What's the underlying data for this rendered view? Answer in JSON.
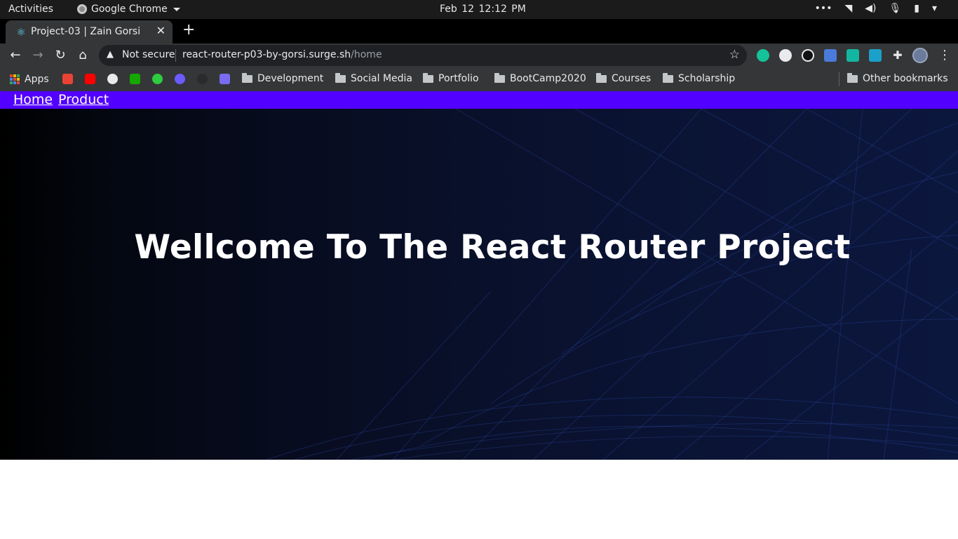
{
  "system": {
    "activities": "Activities",
    "app_name": "Google Chrome",
    "clock": "Feb 12  12:12 PM"
  },
  "browser": {
    "tab_title": "Project-03 | Zain Gorsi",
    "address": {
      "security": "Not secure",
      "host": "react-router-p03-by-gorsi.surge.sh",
      "path": "/home"
    },
    "bookmarks": {
      "apps": "Apps",
      "folders": [
        "Development",
        "Social Media",
        "Portfolio",
        "BootCamp2020",
        "Courses",
        "Scholarship"
      ],
      "other": "Other bookmarks"
    }
  },
  "page": {
    "nav": [
      "Home",
      "Product"
    ],
    "hero_title": "Wellcome To The React Router Project",
    "colors": {
      "nav_bg": "#5200ff",
      "hero_bg": "#0a1230"
    }
  }
}
